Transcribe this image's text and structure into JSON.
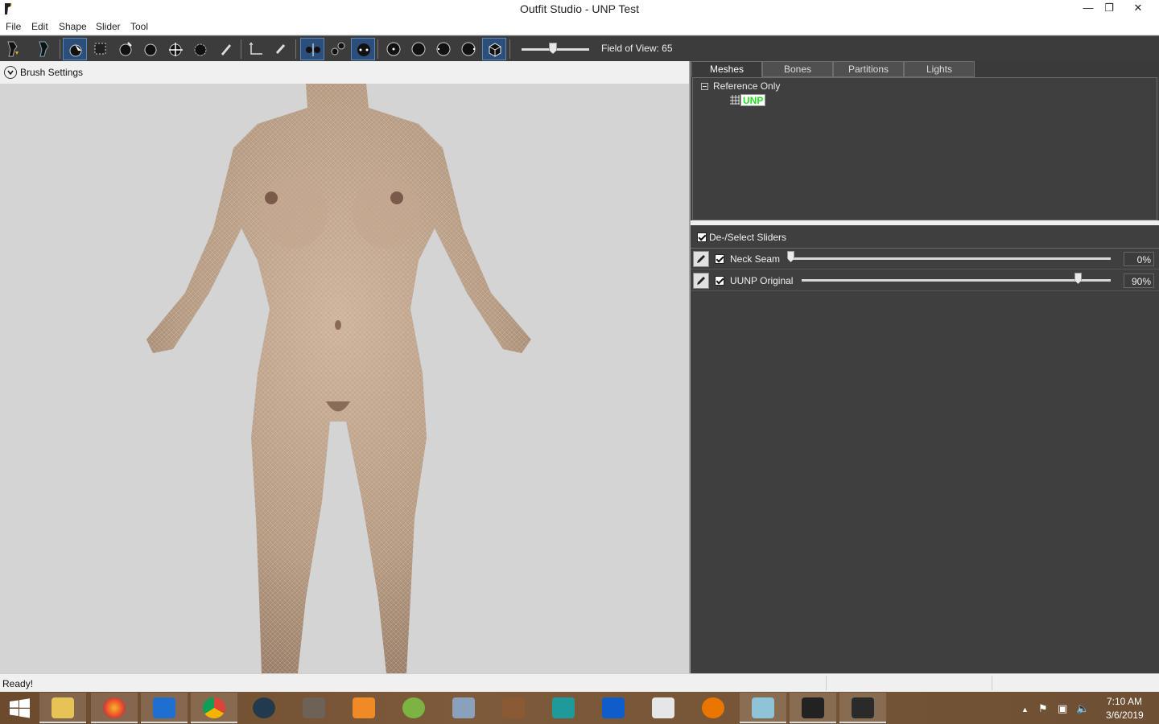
{
  "window": {
    "title": "Outfit Studio - UNP Test",
    "minimize_glyph": "—",
    "restore_glyph": "❐",
    "close_glyph": "✕"
  },
  "menu": [
    "File",
    "Edit",
    "Shape",
    "Slider",
    "Tool"
  ],
  "toolbar": {
    "field_of_view_label": "Field of View: 65",
    "field_of_view_value": 65,
    "icons": [
      "reference-shape-icon",
      "workspace-shape-icon",
      "select-brush-icon",
      "mask-brush-icon",
      "inflate-brush-icon",
      "deflate-brush-icon",
      "move-brush-icon",
      "smooth-brush-icon",
      "weight-brush-icon",
      "transform-icon",
      "pivot-icon",
      "symmetry-x-icon",
      "connected-only-icon",
      "global-brush-collision-icon",
      "wireframe-icon",
      "lighting-icon",
      "mask-view-icon",
      "weight-view-icon",
      "texture-icon"
    ]
  },
  "brush_settings": {
    "label": "Brush Settings"
  },
  "tabs": [
    {
      "label": "Meshes",
      "active": true
    },
    {
      "label": "Bones",
      "active": false
    },
    {
      "label": "Partitions",
      "active": false
    },
    {
      "label": "Lights",
      "active": false
    }
  ],
  "mesh_tree": {
    "root_label": "Reference Only",
    "mesh_label": "UNP",
    "mesh_label_color": "#22dd22"
  },
  "sliders": {
    "header_label": "De-/Select Sliders",
    "items": [
      {
        "name": "Neck Seam",
        "value_text": "0%",
        "value": 0,
        "checked": true
      },
      {
        "name": "UUNP Original",
        "value_text": "90%",
        "value": 90,
        "checked": true
      }
    ]
  },
  "status": {
    "text": "Ready!"
  },
  "taskbar": {
    "apps": [
      "start-icon",
      "file-explorer-icon",
      "firefox-icon",
      "windows-defender-icon",
      "chrome-icon",
      "camera-app-icon",
      "gimp-icon",
      "media-player-icon",
      "android-studio-icon",
      "virtualbox-icon",
      "anvil-icon",
      "3ds-max-icon",
      "teamviewer-icon",
      "mb-tool-icon",
      "blender-icon",
      "nifskope-icon",
      "outfit-studio-icon",
      "outfit-studio-2-icon"
    ],
    "clock_time": "7:10 AM",
    "clock_date": "3/6/2019",
    "tray_up_glyph": "▲",
    "flag_glyph": "⚑",
    "network_glyph": "▣",
    "volume_glyph": "🔈"
  },
  "colors": {
    "toolbar_bg": "#3c3c3c",
    "panel_bg": "#3f3f3f",
    "viewport_bg": "#d4d4d4",
    "accent_active": "#2b4f7a"
  }
}
